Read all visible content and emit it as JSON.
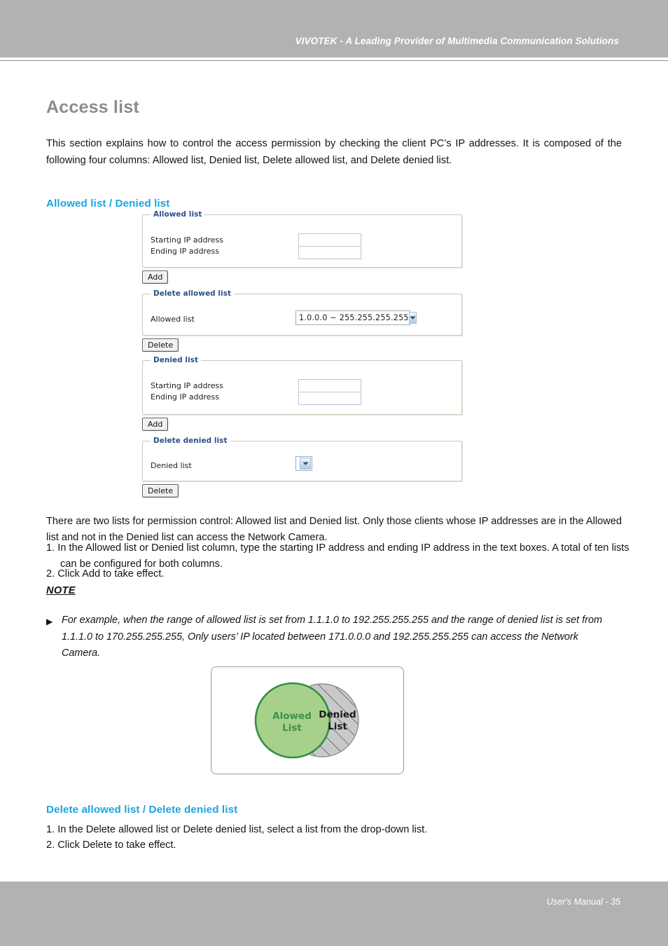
{
  "header": {
    "title": "VIVOTEK - A Leading Provider of Multimedia Communication Solutions"
  },
  "page": {
    "title": "Access list",
    "intro": "This section explains how to control the access permission by checking the client PC’s IP addresses. It is composed of the following four columns: Allowed list, Denied list, Delete allowed list, and Delete denied list."
  },
  "sections": {
    "allowed_denied_heading": "Allowed list / Denied list",
    "delete_heading": "Delete allowed list / Delete denied list"
  },
  "forms": {
    "allowed_list": {
      "legend": "Allowed list",
      "label_start": "Starting IP address",
      "label_end": "Ending IP address",
      "value_start": "",
      "value_end": "",
      "button": "Add"
    },
    "delete_allowed_list": {
      "legend": "Delete allowed list",
      "label": "Allowed list",
      "selected_option": "1.0.0.0 ~ 255.255.255.255",
      "button": "Delete"
    },
    "denied_list": {
      "legend": "Denied list",
      "label_start": "Starting IP address",
      "label_end": "Ending IP address",
      "value_start": "",
      "value_end": "",
      "button": "Add"
    },
    "delete_denied_list": {
      "legend": "Delete denied list",
      "label": "Denied list",
      "selected_option": "",
      "button": "Delete"
    }
  },
  "explanation": {
    "para1": "There are two lists for permission control: Allowed list and Denied list. Only those clients whose IP addresses are in the Allowed list and not in the Denied list can access the Network Camera.",
    "step1": "1. In the Allowed list or Denied list column, type the starting IP address and ending IP address in the text boxes. A total of ten lists can be configured for both columns.",
    "step2": "2. Click Add to take effect."
  },
  "note": {
    "label": "NOTE",
    "bullet": "▶",
    "text": "For example, when the range of allowed list is set from 1.1.1.0 to 192.255.255.255 and the range of denied list is set from 1.1.1.0 to 170.255.255.255, Only users’ IP located between 171.0.0.0 and 192.255.255.255 can access the Network Camera."
  },
  "venn": {
    "allowed_line1": "Alowed",
    "allowed_line2": "List",
    "denied_line1": "Denied",
    "denied_line2": "List",
    "allowed_fill": "#a7d18a",
    "allowed_stroke": "#2e9148",
    "allowed_text_color": "#3f8f4e",
    "denied_fill": "#c9c9c9",
    "denied_stroke": "#8f8f8f",
    "denied_text_color": "#1a1a1a"
  },
  "delete_steps": {
    "step1": "1. In the Delete allowed list or Delete denied list, select a list from the drop-down list.",
    "step2": "2. Click Delete to take effect."
  },
  "footer": {
    "text": "User's Manual - 35"
  },
  "colors": {
    "header_bar": "#b0b2b4",
    "heading_blue": "#1ca4e0",
    "title_grey": "#8a8c8e"
  }
}
